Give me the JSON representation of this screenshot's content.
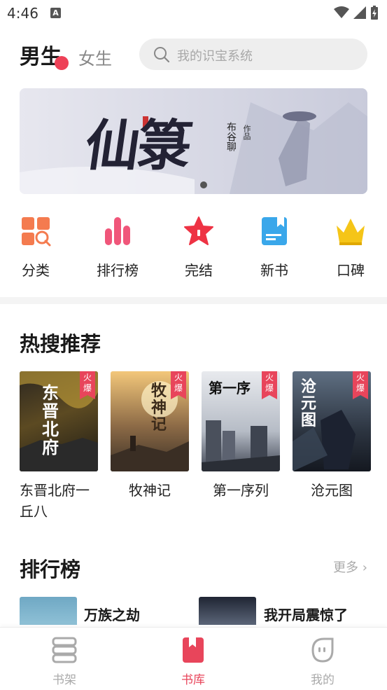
{
  "status_bar": {
    "time": "4:46",
    "notif_letter": "A"
  },
  "header": {
    "tab_male": "男生",
    "tab_female": "女生",
    "search_placeholder": "我的识宝系统"
  },
  "banner": {
    "title": "仙箓",
    "author": "布谷聊",
    "author_suffix": "作品",
    "page_indicator": {
      "current": 1,
      "total": 1
    }
  },
  "categories": [
    {
      "label": "分类",
      "icon": "category-grid-icon"
    },
    {
      "label": "排行榜",
      "icon": "ranking-bars-icon"
    },
    {
      "label": "完结",
      "icon": "star-icon"
    },
    {
      "label": "新书",
      "icon": "new-book-icon"
    },
    {
      "label": "口碑",
      "icon": "crown-icon"
    }
  ],
  "hot_search": {
    "title": "热搜推荐",
    "books": [
      {
        "title": "东晋北府一丘八",
        "tag": "火爆",
        "cover_text": "东晋北府"
      },
      {
        "title": "牧神记",
        "tag": "火爆",
        "cover_text": "牧神记"
      },
      {
        "title": "第一序列",
        "tag": "火爆",
        "cover_text": "第一序"
      },
      {
        "title": "沧元图",
        "tag": "火爆",
        "cover_text": "沧元图"
      }
    ]
  },
  "ranking": {
    "title": "排行榜",
    "more": "更多",
    "items": [
      {
        "title": "万族之劫"
      },
      {
        "title": "我开局震惊了"
      }
    ]
  },
  "bottom_nav": [
    {
      "label": "书架",
      "icon": "bookshelf-icon",
      "active": false
    },
    {
      "label": "书库",
      "icon": "library-icon",
      "active": true
    },
    {
      "label": "我的",
      "icon": "profile-icon",
      "active": false
    }
  ],
  "colors": {
    "accent": "#e8455b",
    "category_orange": "#f47b4f",
    "category_pink": "#f0567a",
    "category_red": "#ee3344",
    "category_blue": "#3aa7ea",
    "category_gold": "#f5c518"
  }
}
